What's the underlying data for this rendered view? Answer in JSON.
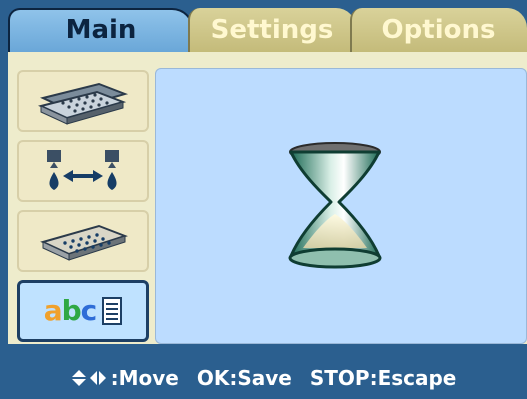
{
  "tabs": {
    "main": "Main",
    "settings": "Settings",
    "options": "Options"
  },
  "sidebar": {
    "items": [
      {
        "icon": "plates-icon"
      },
      {
        "icon": "dispense-transfer-icon"
      },
      {
        "icon": "single-plate-icon"
      },
      {
        "icon": "abc-list-icon",
        "text_a": "a",
        "text_b": "b",
        "text_c": "c"
      }
    ]
  },
  "status": {
    "icon": "hourglass-icon"
  },
  "help": {
    "move": ":Move",
    "ok": "OK:Save",
    "stop": "STOP:Escape"
  },
  "colors": {
    "tab_active": "#7fb8e6",
    "tab_inactive": "#d2ca8d",
    "frame": "#2b5f8f",
    "panel": "#eeeccc",
    "viewport": "#bcdcff"
  }
}
